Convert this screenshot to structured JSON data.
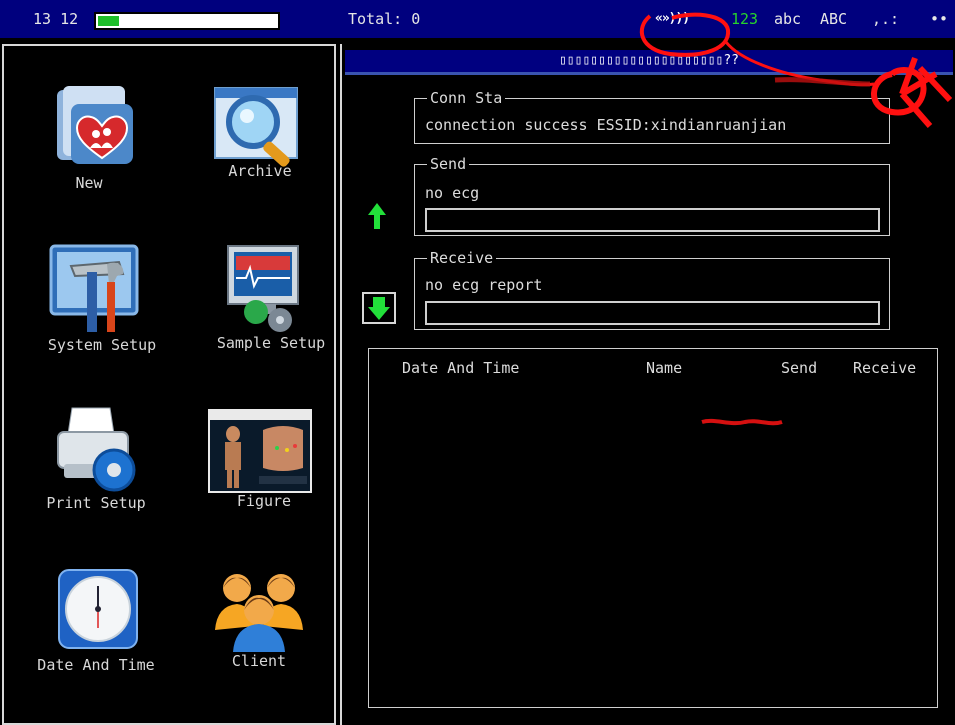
{
  "status_bar": {
    "time": "13 12",
    "battery_level": 0.12,
    "total_label": "Total: 0",
    "wifi_glyph": "«»)))",
    "input_modes": [
      "123",
      "abc",
      "ABC",
      ",.:",
      "••"
    ]
  },
  "menu": {
    "items": [
      {
        "label": "New",
        "icon": "folder-heart-icon"
      },
      {
        "label": "Archive",
        "icon": "magnifier-window-icon"
      },
      {
        "label": "System Setup",
        "icon": "hammer-wrench-icon"
      },
      {
        "label": "Sample Setup",
        "icon": "monitor-gear-icon"
      },
      {
        "label": "Print Setup",
        "icon": "printer-gear-icon"
      },
      {
        "label": "Figure",
        "icon": "body-figure-icon"
      },
      {
        "label": "Date And Time",
        "icon": "clock-icon"
      },
      {
        "label": "Client",
        "icon": "users-icon"
      }
    ]
  },
  "window": {
    "title": "▯▯▯▯▯▯▯▯▯▯▯▯▯▯▯▯▯▯▯▯▯??"
  },
  "conn_status": {
    "legend": "Conn Sta",
    "value": "connection success ESSID:xindianruanjian"
  },
  "send": {
    "legend": "Send",
    "value": "no ecg",
    "progress": 0
  },
  "receive": {
    "legend": "Receive",
    "value": "no ecg report",
    "progress": 0
  },
  "table": {
    "headers": [
      "Date And Time",
      "Name",
      "Send",
      "Receive"
    ],
    "rows": []
  },
  "colors": {
    "status_bar": "#00007e",
    "battery_fill": "#1fbf2a",
    "arrow_green": "#22e03a",
    "mode_123": "#27d32c",
    "annotation_red": "#ff1010"
  }
}
